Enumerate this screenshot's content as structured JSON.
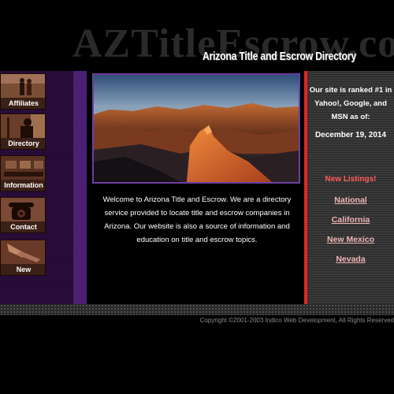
{
  "header": {
    "ghost_text": "AZTitleEscrow.com",
    "title": "Arizona Title and Escrow Directory"
  },
  "nav": {
    "items": [
      {
        "label": "Affiliates",
        "icon": "people-icon"
      },
      {
        "label": "Directory",
        "icon": "person-reading-icon"
      },
      {
        "label": "Information",
        "icon": "office-icon"
      },
      {
        "label": "Contact",
        "icon": "telephone-icon"
      },
      {
        "label": "New",
        "icon": "hand-icon"
      }
    ]
  },
  "main": {
    "welcome": "Welcome to Arizona Title and Escrow. We are a directory service provided to locate title and escrow companies in Arizona. Our website is also a source of information and education on title and escrow topics."
  },
  "sidebar": {
    "rank_text": "Our site is ranked #1 in Yahoo!, Google, and MSN as of:",
    "rank_date": "December 19, 2014",
    "new_listings": "New Listings!",
    "links": [
      "National",
      "California",
      "New Mexico",
      "Nevada"
    ]
  },
  "footer": {
    "copyright": "Copyright ©2001-2003 Indico Web Development, All Rights Reserved"
  },
  "colors": {
    "background": "#000000",
    "nav_purple": "#2a0d3c",
    "accent_red": "#e0281e",
    "new_listings_red": "#ff5a5a",
    "link_pink": "#f0b4b4"
  }
}
